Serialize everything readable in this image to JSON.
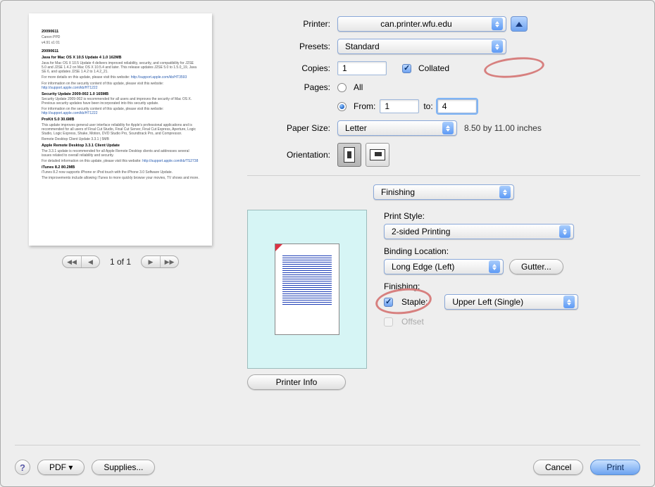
{
  "labels": {
    "printer": "Printer:",
    "presets": "Presets:",
    "copies": "Copies:",
    "collated": "Collated",
    "pages": "Pages:",
    "all": "All",
    "from": "From:",
    "to": "to:",
    "paper_size": "Paper Size:",
    "orientation": "Orientation:",
    "print_style": "Print Style:",
    "binding_location": "Binding Location:",
    "gutter": "Gutter...",
    "finishing": "Finishing:",
    "staple": "Staple:",
    "offset": "Offset",
    "printer_info": "Printer Info",
    "help": "?",
    "pdf": "PDF ▾",
    "supplies": "Supplies...",
    "cancel": "Cancel",
    "print": "Print"
  },
  "preview": {
    "page_counter": "1 of 1"
  },
  "printer": {
    "selected": "can.printer.wfu.edu"
  },
  "presets": {
    "selected": "Standard"
  },
  "copies": {
    "value": "1",
    "collated": true
  },
  "pages": {
    "mode": "from",
    "from": "1",
    "to": "4"
  },
  "paper_size": {
    "selected": "Letter",
    "dimensions": "8.50 by 11.00 inches"
  },
  "orientation": "portrait",
  "section": {
    "selected": "Finishing"
  },
  "finishing": {
    "print_style": "2-sided Printing",
    "binding_location": "Long Edge (Left)",
    "staple_enabled": true,
    "staple_position": "Upper Left (Single)",
    "offset_enabled": false
  }
}
